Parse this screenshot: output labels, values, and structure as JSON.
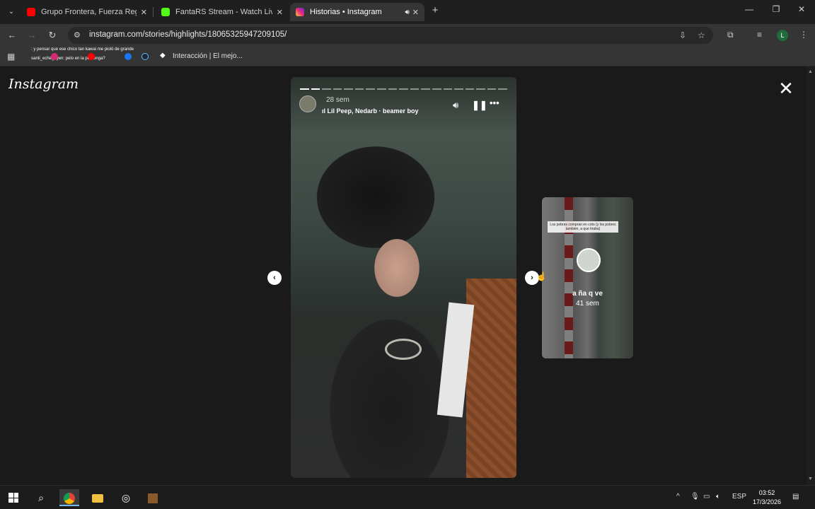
{
  "browser": {
    "tabs": [
      {
        "title": "Grupo Frontera, Fuerza Regida",
        "favicon_color": "#ff0000",
        "active": false
      },
      {
        "title": "FantaRS Stream - Watch Live on",
        "favicon_color": "#53fc18",
        "active": false
      },
      {
        "title": "Historias • Instagram",
        "favicon_color": "#d62976",
        "active": true
      }
    ],
    "new_tab_label": "+",
    "url": "instagram.com/stories/highlights/18065325947209105/",
    "profile_initial": "L",
    "bookmarks": {
      "tiny_line1": ": y pensar que ese chico tan kawai me pioló de grande",
      "tiny_line2": "santi_echegoyen: pelo en la pomonga?",
      "item_label": "Interacción | El mejo..."
    }
  },
  "page": {
    "logo": "Instagram",
    "story": {
      "time": "28 sem",
      "music": "Lil Peep, Nedarb · beamer boy",
      "segments_total": 19,
      "segments_done": 2
    },
    "next_story": {
      "caption": "Los pobres compran en coto (y los pobres también, a que tiraba)",
      "name": "a ña q ve",
      "time": "41 sem"
    }
  },
  "taskbar": {
    "tray_lang": "ESP",
    "time": "03:52",
    "date": "17/3/2026"
  },
  "colors": {
    "chrome_bg": "#1f1f1f",
    "toolbar_bg": "#353535",
    "page_bg": "#1a1a1a",
    "taskbar_accent": "#76b9ed"
  }
}
